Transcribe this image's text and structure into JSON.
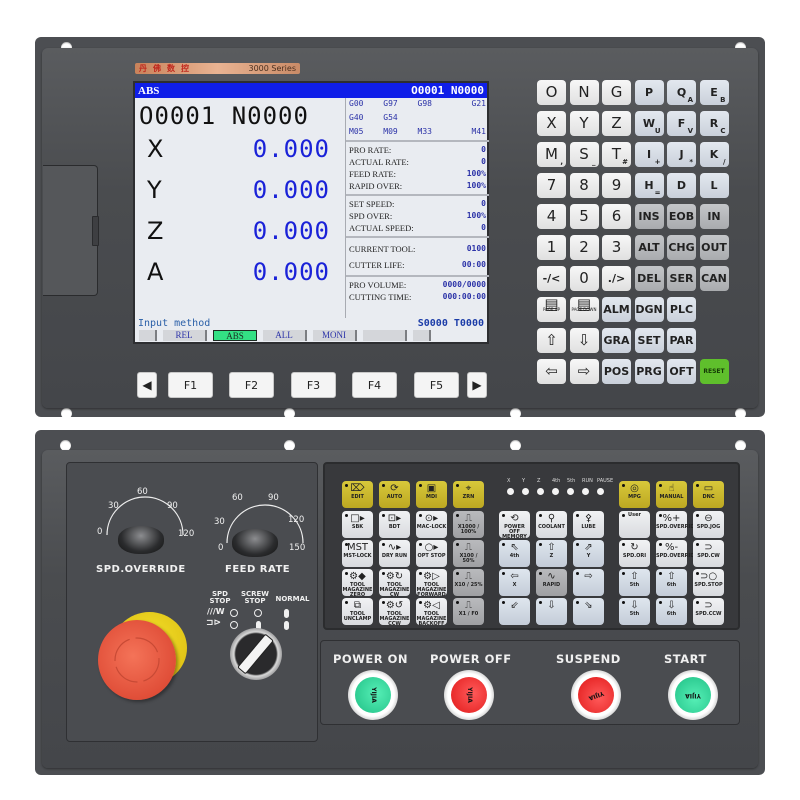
{
  "brand": {
    "name_cn": "丹佛数控",
    "series": "3000 Series"
  },
  "lcd": {
    "mode": "ABS",
    "header_program": "O0001 N0000",
    "program_line": "O0001 N0000",
    "axes": [
      {
        "name": "X",
        "value": "0.000"
      },
      {
        "name": "Y",
        "value": "0.000"
      },
      {
        "name": "Z",
        "value": "0.000"
      },
      {
        "name": "A",
        "value": "0.000"
      }
    ],
    "gcodes": [
      "G00",
      "G97",
      "G98",
      "G21",
      "G40",
      "G54",
      "",
      "",
      "M05",
      "M09",
      "M33",
      "M41"
    ],
    "rates": [
      {
        "label": "PRO RATE:",
        "value": "0"
      },
      {
        "label": "ACTUAL RATE:",
        "value": "0"
      },
      {
        "label": "FEED RATE:",
        "value": "100%"
      },
      {
        "label": "RAPID OVER:",
        "value": "100%"
      }
    ],
    "spindle": [
      {
        "label": "SET SPEED:",
        "value": "0"
      },
      {
        "label": "SPD OVER:",
        "value": "100%"
      },
      {
        "label": "ACTUAL SPEED:",
        "value": "0"
      }
    ],
    "tool": [
      {
        "label": "CURRENT TOOL:",
        "value": "0100"
      },
      {
        "label": "CUTTER LIFE:",
        "value": "00:00"
      }
    ],
    "volume": [
      {
        "label": "PRO VOLUME:",
        "value": "0000/0000"
      },
      {
        "label": "CUTTING TIME:",
        "value": "000:00:00"
      }
    ],
    "status_left": "Input method",
    "spindle_code": "S0000",
    "tool_code": "T0000",
    "softkeys": [
      "",
      "REL",
      "ABS",
      "ALL",
      "MONI",
      "",
      ""
    ],
    "active_softkey": "ABS"
  },
  "fkeys": {
    "prev": "◀",
    "next": "▶",
    "labels": [
      "F1",
      "F2",
      "F3",
      "F4",
      "F5"
    ]
  },
  "keypad": {
    "rows": [
      [
        {
          "k": "O"
        },
        {
          "k": "N"
        },
        {
          "k": "G"
        },
        {
          "k": "P"
        },
        {
          "k": "Q",
          "s": "A"
        },
        {
          "k": "E",
          "s": "B"
        }
      ],
      [
        {
          "k": "X"
        },
        {
          "k": "Y"
        },
        {
          "k": "Z"
        },
        {
          "k": "W",
          "s": "U"
        },
        {
          "k": "F",
          "s": "V"
        },
        {
          "k": "R",
          "s": "C"
        }
      ],
      [
        {
          "k": "M",
          "s": ","
        },
        {
          "k": "S",
          "s": "_"
        },
        {
          "k": "T",
          "s": "#"
        },
        {
          "k": "I",
          "s": "+"
        },
        {
          "k": "J",
          "s": "*"
        },
        {
          "k": "K",
          "s": "/"
        }
      ],
      [
        {
          "k": "7"
        },
        {
          "k": "8"
        },
        {
          "k": "9"
        },
        {
          "k": "H",
          "s": "="
        },
        {
          "k": "D"
        },
        {
          "k": "L"
        }
      ],
      [
        {
          "k": "4"
        },
        {
          "k": "5"
        },
        {
          "k": "6"
        },
        {
          "k": "INS"
        },
        {
          "k": "EOB"
        },
        {
          "k": "IN"
        }
      ],
      [
        {
          "k": "1"
        },
        {
          "k": "2"
        },
        {
          "k": "3"
        },
        {
          "k": "ALT"
        },
        {
          "k": "CHG"
        },
        {
          "k": "OUT"
        }
      ],
      [
        {
          "k": "-/<"
        },
        {
          "k": "0"
        },
        {
          "k": "./>"
        },
        {
          "k": "DEL"
        },
        {
          "k": "SER"
        },
        {
          "k": "CAN"
        }
      ]
    ],
    "nav_rows": [
      [
        {
          "k": "▤",
          "s": "PAGE UP"
        },
        {
          "k": "▤",
          "s": "PAGE DOWN"
        },
        {
          "k": "ALM"
        },
        {
          "k": "DGN"
        },
        {
          "k": "PLC"
        }
      ],
      [
        {
          "k": "⇧"
        },
        {
          "k": "⇩"
        },
        {
          "k": "GRA"
        },
        {
          "k": "SET"
        },
        {
          "k": "PAR"
        }
      ],
      [
        {
          "k": "⇦"
        },
        {
          "k": "⇨"
        },
        {
          "k": "POS"
        },
        {
          "k": "PRG"
        },
        {
          "k": "OFT"
        },
        {
          "k": "RESET"
        }
      ]
    ]
  },
  "dials": {
    "spindle_override": {
      "label": "SPD.OVERRIDE",
      "ticks": [
        "0",
        "30",
        "60",
        "90",
        "120"
      ]
    },
    "feed_rate": {
      "label": "FEED RATE",
      "ticks": [
        "0",
        "30",
        "60",
        "90",
        "120",
        "150"
      ]
    }
  },
  "selector": {
    "labels": [
      "SPD STOP",
      "SCREW STOP",
      "NORMAL"
    ]
  },
  "mode_keys": [
    {
      "id": "edit",
      "label": "EDIT",
      "icon": "⌦"
    },
    {
      "id": "auto",
      "label": "AUTO",
      "icon": "⟳"
    },
    {
      "id": "mdi",
      "label": "MDI",
      "icon": "▣"
    },
    {
      "id": "zrn",
      "label": "ZRN",
      "icon": "⌖"
    },
    {
      "id": "mpg",
      "label": "MPG",
      "icon": "◎"
    },
    {
      "id": "manual",
      "label": "MANUAL",
      "icon": "☝"
    },
    {
      "id": "dnc",
      "label": "DNC",
      "icon": "▭"
    }
  ],
  "func_keys_left": [
    [
      {
        "l": "SBK",
        "i": "□▸"
      },
      {
        "l": "BDT",
        "i": "⊡▸"
      },
      {
        "l": "MAC-LOCK",
        "i": "⊙▸"
      },
      {
        "l": "X1000 / 100%",
        "i": "⎍"
      }
    ],
    [
      {
        "l": "MST-LOCK",
        "i": "MST"
      },
      {
        "l": "DRY RUN",
        "i": "∿▸"
      },
      {
        "l": "OPT STOP",
        "i": "○▸"
      },
      {
        "l": "X100 / 50%",
        "i": "⎍"
      }
    ],
    [
      {
        "l": "TOOL MAGAZINE ZERO",
        "i": "⚙◆"
      },
      {
        "l": "TOOL MAGAZINE CW",
        "i": "⚙↻"
      },
      {
        "l": "TOOL MAGAZINE FORWARD",
        "i": "⚙▷"
      },
      {
        "l": "X10 / 25%",
        "i": "⎍"
      }
    ],
    [
      {
        "l": "TOOL UNCLAMP",
        "i": "⧉"
      },
      {
        "l": "TOOL MAGAZINE CCW",
        "i": "⚙↺"
      },
      {
        "l": "TOOL MAGAZINE BACKOFF",
        "i": "⚙◁"
      },
      {
        "l": "X1 / F0",
        "i": "⎍"
      }
    ]
  ],
  "axis_leds": [
    "X",
    "Y",
    "Z",
    "4th",
    "5th",
    "RUN",
    "PAUSE"
  ],
  "func_keys_right": [
    [
      {
        "l": "POWER OFF MEMORY",
        "i": "⟲"
      },
      {
        "l": "COOLANT",
        "i": "⚲"
      },
      {
        "l": "LUBE",
        "i": "⚴"
      },
      {
        "l": "User",
        "i": ""
      },
      {
        "l": "SPD.OVERRIDE",
        "i": "%+"
      },
      {
        "l": "SPD.JOG",
        "i": "⊖"
      }
    ],
    [
      {
        "l": "4th",
        "i": "⇖"
      },
      {
        "l": "Z",
        "i": "⇧"
      },
      {
        "l": "Y",
        "i": "⇗"
      },
      {
        "l": "SPD.ORI",
        "i": "↻"
      },
      {
        "l": "SPD.OVERRIDE",
        "i": "%-"
      },
      {
        "l": "SPD.CW",
        "i": "⊃"
      }
    ],
    [
      {
        "l": "X",
        "i": "⇦"
      },
      {
        "l": "RAPID",
        "i": "∿"
      },
      {
        "l": "",
        "i": "⇨"
      },
      {
        "l": "5th",
        "i": "⇧"
      },
      {
        "l": "6th",
        "i": "⇧"
      },
      {
        "l": "SPD.STOP",
        "i": "⊃○"
      }
    ],
    [
      {
        "l": "",
        "i": "⇙"
      },
      {
        "l": "",
        "i": "⇩"
      },
      {
        "l": "",
        "i": "⇘"
      },
      {
        "l": "5th",
        "i": "⇩"
      },
      {
        "l": "6th",
        "i": "⇩"
      },
      {
        "l": "SPD.CCW",
        "i": "⊃"
      }
    ]
  ],
  "big_buttons": [
    {
      "label": "POWER ON",
      "cap": "YIJIA",
      "color": "green"
    },
    {
      "label": "POWER OFF",
      "cap": "YIJIA",
      "color": "red"
    },
    {
      "label": "SUSPEND",
      "cap": "YIJIA",
      "color": "red"
    },
    {
      "label": "START",
      "cap": "YIJIA",
      "color": "green"
    }
  ],
  "colors": {
    "lcd_header": "#0f1ee8",
    "lcd_value": "#1a22d8",
    "active_softkey": "#33e084",
    "reset_key": "#5fbf2c",
    "mode_key": "#d8c83a",
    "estop": "#e04e38"
  }
}
